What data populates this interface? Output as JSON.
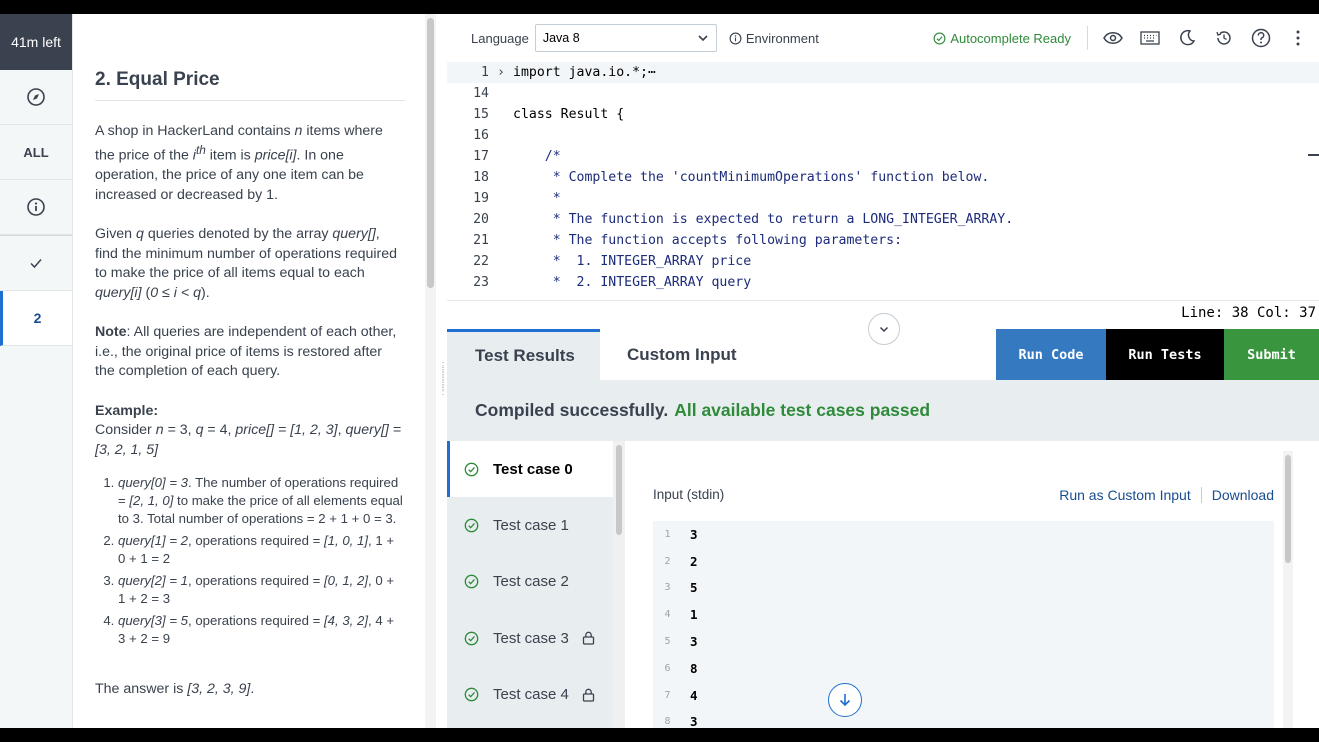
{
  "rail": {
    "timer": "41m left",
    "all_label": "ALL",
    "question_number": "2",
    "icons": [
      "compass-icon",
      "info-icon",
      "check-icon"
    ]
  },
  "problem": {
    "title": "2. Equal Price",
    "intro_a": "A shop in HackerLand contains ",
    "intro_n": "n",
    "intro_b": " items where the price of the ",
    "intro_i": "i",
    "intro_th": "th",
    "intro_c": " item is ",
    "intro_price": "price[i]",
    "intro_d": ".  In one operation, the price of any one item can be increased or decreased by 1.",
    "given_a": "Given ",
    "given_q": "q",
    "given_b": " queries denoted by the array ",
    "given_query": "query[]",
    "given_c": ", find the minimum number of operations required to make the price of all items equal to each ",
    "given_queryi": "query[i]",
    "given_d": " (",
    "given_range": "0 ≤ i < q",
    "given_e": ").",
    "note_label": "Note",
    "note_text": ": All queries are independent of each other, i.e., the original price of items is restored after the completion of each query.",
    "example_label": "Example:",
    "example_a": "Consider ",
    "example_n": "n",
    "example_b": " = 3, ",
    "example_q": "q",
    "example_c": " = 4, ",
    "example_price": "price[] = [1, 2, 3]",
    "example_d": ", ",
    "example_query": "query[] = [3, 2, 1, 5]",
    "steps": [
      {
        "q": "query[0] = 3",
        "a": ". The number of operations required = ",
        "ops": "[2, 1, 0]",
        "b": " to make the price of all elements equal to 3. Total number of operations = 2 + 1 + 0 = 3."
      },
      {
        "q": "query[1] = 2",
        "a": ", operations required = ",
        "ops": "[1, 0, 1]",
        "b": ", 1 + 0 + 1 = 2"
      },
      {
        "q": "query[2] = 1",
        "a": ", operations required = ",
        "ops": "[0, 1, 2]",
        "b": ", 0 + 1 + 2 = 3"
      },
      {
        "q": "query[3] = 5",
        "a": ", operations required = ",
        "ops": "[4, 3, 2]",
        "b": ", 4 + 3 + 2 = 9"
      }
    ],
    "answer_a": "The answer is ",
    "answer_val": "[3, 2, 3, 9]",
    "answer_b": "."
  },
  "toolbar": {
    "language_label": "Language",
    "language_value": "Java 8",
    "environment_label": "Environment",
    "autocomplete_label": "Autocomplete Ready"
  },
  "editor": {
    "lines": [
      {
        "n": "1",
        "text": "import java.io.*;⋯",
        "fold": "›",
        "comment": false
      },
      {
        "n": "14",
        "text": "",
        "fold": "",
        "comment": false
      },
      {
        "n": "15",
        "text": "class Result {",
        "fold": "",
        "comment": false
      },
      {
        "n": "16",
        "text": "",
        "fold": "",
        "comment": false
      },
      {
        "n": "17",
        "text": "    /*",
        "fold": "",
        "comment": true
      },
      {
        "n": "18",
        "text": "     * Complete the 'countMinimumOperations' function below.",
        "fold": "",
        "comment": true
      },
      {
        "n": "19",
        "text": "     *",
        "fold": "",
        "comment": true
      },
      {
        "n": "20",
        "text": "     * The function is expected to return a LONG_INTEGER_ARRAY.",
        "fold": "",
        "comment": true
      },
      {
        "n": "21",
        "text": "     * The function accepts following parameters:",
        "fold": "",
        "comment": true
      },
      {
        "n": "22",
        "text": "     *  1. INTEGER_ARRAY price",
        "fold": "",
        "comment": true
      },
      {
        "n": "23",
        "text": "     *  2. INTEGER_ARRAY query",
        "fold": "",
        "comment": true
      }
    ],
    "status": "Line: 38 Col: 37"
  },
  "bottom": {
    "tab_results": "Test Results",
    "tab_custom": "Custom Input",
    "run_code": "Run Code",
    "run_tests": "Run Tests",
    "submit": "Submit",
    "compiled": "Compiled successfully.",
    "passed": "All available test cases passed"
  },
  "cases": [
    {
      "label": "Test case 0",
      "locked": false
    },
    {
      "label": "Test case 1",
      "locked": false
    },
    {
      "label": "Test case 2",
      "locked": false
    },
    {
      "label": "Test case 3",
      "locked": true
    },
    {
      "label": "Test case 4",
      "locked": true
    }
  ],
  "detail": {
    "input_label": "Input (stdin)",
    "run_custom": "Run as Custom Input",
    "download": "Download",
    "rows": [
      {
        "n": "1",
        "v": "3"
      },
      {
        "n": "2",
        "v": "2"
      },
      {
        "n": "3",
        "v": "5"
      },
      {
        "n": "4",
        "v": "1"
      },
      {
        "n": "5",
        "v": "3"
      },
      {
        "n": "6",
        "v": "8"
      },
      {
        "n": "7",
        "v": "4"
      },
      {
        "n": "8",
        "v": "3"
      }
    ]
  },
  "colors": {
    "accent": "#1f6fd0",
    "success": "#2f8a3a",
    "run_code": "#3579c1",
    "submit": "#39963e"
  }
}
